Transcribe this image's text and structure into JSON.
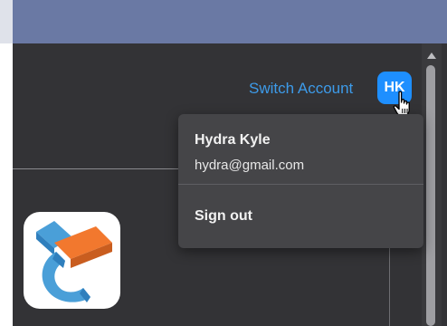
{
  "header": {
    "switch_account_label": "Switch Account",
    "avatar_initials": "HK"
  },
  "account_menu": {
    "user_name": "Hydra Kyle",
    "user_email": "hydra@gmail.com",
    "sign_out_label": "Sign out"
  },
  "colors": {
    "accent_link": "#3d9be9",
    "avatar_bg": "#1e8fff",
    "top_bar": "#6a79a4",
    "app_bg": "#333336",
    "menu_bg": "#454548"
  },
  "icons": {
    "logo": "app-logo-icon",
    "cursor": "hand-pointer-icon",
    "scroll_up": "scroll-up-arrow-icon"
  }
}
